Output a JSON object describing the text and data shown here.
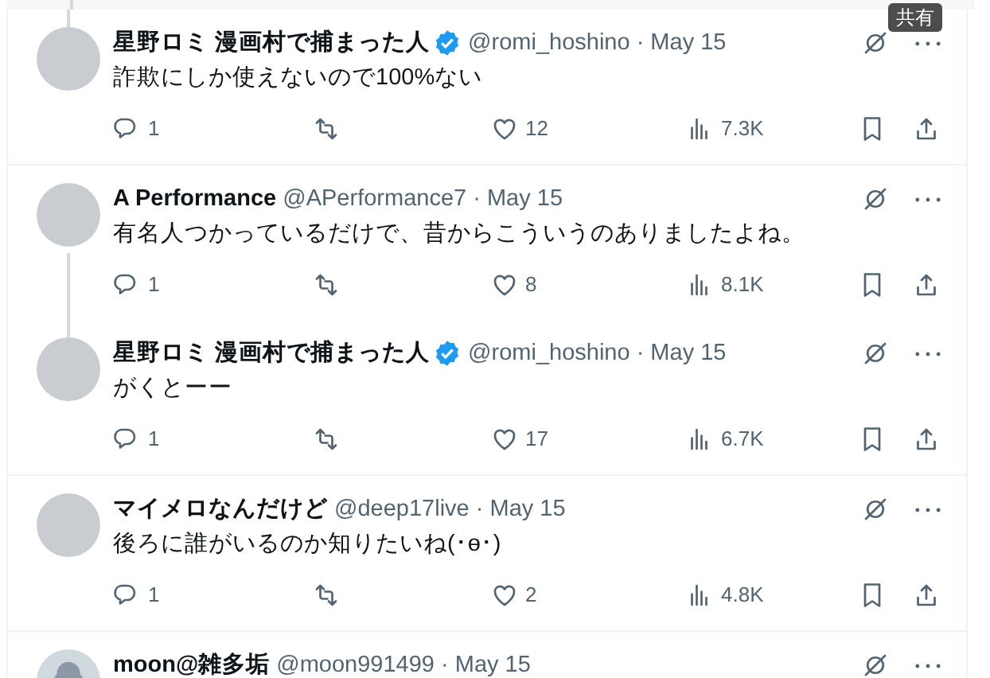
{
  "tooltip": "共有",
  "tweets": [
    {
      "name": "星野ロミ 漫画村で捕まった人",
      "verified": true,
      "handle": "@romi_hoshino",
      "date": "· May 15",
      "text": "詐欺にしか使えないので100%ない",
      "replies": "1",
      "likes": "12",
      "views": "7.3K",
      "default_avatar": false,
      "thread_above": true,
      "thread_below": false
    },
    {
      "name": "A Performance",
      "verified": false,
      "handle": "@APerformance7",
      "date": "· May 15",
      "text": "有名人つかっているだけで、昔からこういうのありましたよね。",
      "replies": "1",
      "likes": "8",
      "views": "8.1K",
      "default_avatar": false,
      "thread_above": false,
      "thread_below": true
    },
    {
      "name": "星野ロミ 漫画村で捕まった人",
      "verified": true,
      "handle": "@romi_hoshino",
      "date": "· May 15",
      "text": "がくとーー",
      "replies": "1",
      "likes": "17",
      "views": "6.7K",
      "default_avatar": false,
      "thread_above": true,
      "thread_below": false
    },
    {
      "name": "マイメロなんだけど",
      "verified": false,
      "handle": "@deep17live",
      "date": "· May 15",
      "text": "後ろに誰がいるのか知りたいね(･ө･)",
      "replies": "1",
      "likes": "2",
      "views": "4.8K",
      "default_avatar": false,
      "thread_above": false,
      "thread_below": false
    },
    {
      "name": "moon@雑多垢",
      "verified": false,
      "handle": "@moon991499",
      "date": "· May 15",
      "default_avatar": true,
      "thread_above": false,
      "thread_below": false
    }
  ]
}
